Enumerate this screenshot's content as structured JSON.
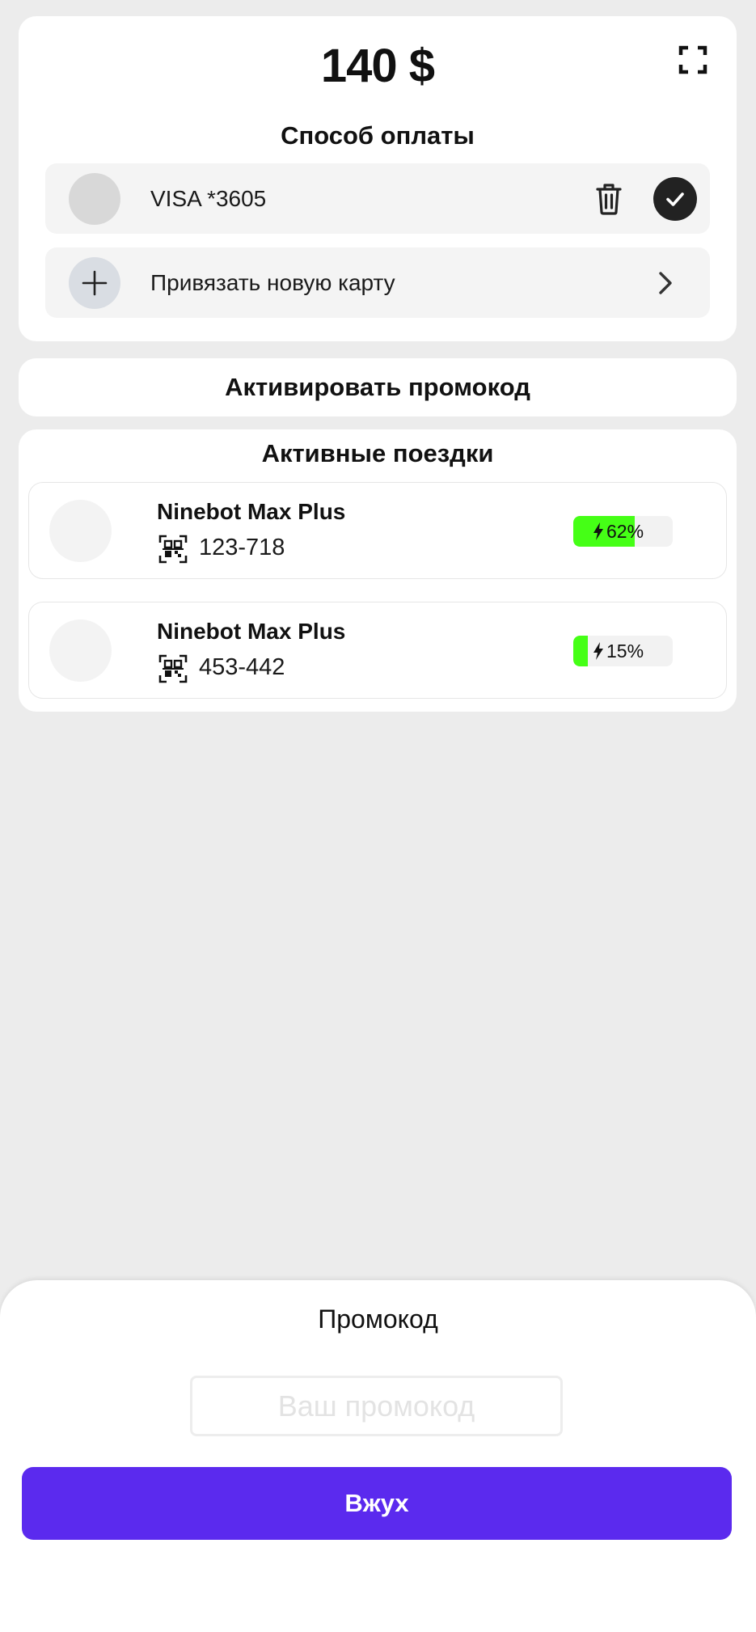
{
  "balance": "140 $",
  "payment": {
    "title": "Способ оплаты",
    "card_label": "VISA *3605",
    "add_card_label": "Привязать новую карту"
  },
  "promo_bar": {
    "label": "Активировать промокод"
  },
  "rides": {
    "title": "Активные поездки",
    "items": [
      {
        "name": "Ninebot Max Plus",
        "number": "123-718",
        "battery_label": "62%",
        "battery_level": 62
      },
      {
        "name": "Ninebot Max Plus",
        "number": "453-442",
        "battery_label": "15%",
        "battery_level": 15
      }
    ]
  },
  "sheet": {
    "title": "Промокод",
    "input_placeholder": "Ваш промокод",
    "input_value": "",
    "submit_label": "Вжух"
  },
  "colors": {
    "accent": "#5b2aee",
    "battery": "#45ff16",
    "background": "#ececec"
  },
  "icons": {
    "expand": "expand-icon",
    "trash": "trash-icon",
    "check": "check-icon",
    "plus": "plus-icon",
    "chevron": "chevron-right-icon",
    "qr": "qr-scan-icon",
    "bolt": "bolt-icon"
  }
}
